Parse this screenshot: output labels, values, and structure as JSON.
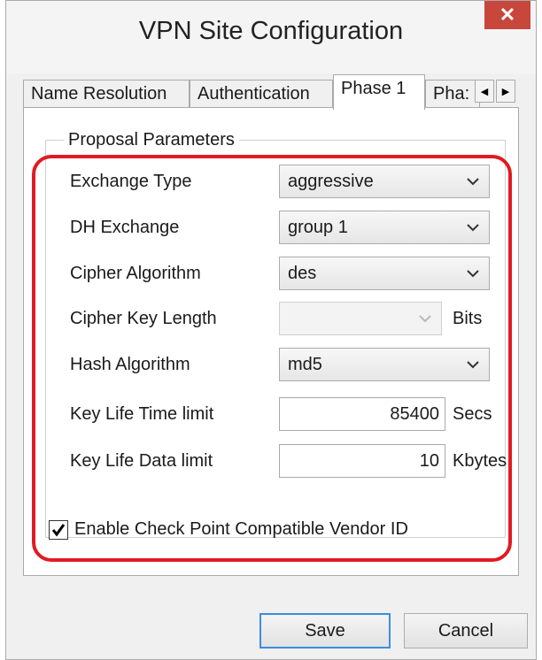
{
  "window": {
    "title": "VPN Site Configuration",
    "close_glyph": "✕"
  },
  "tabs": [
    {
      "label": "Name Resolution",
      "active": false
    },
    {
      "label": "Authentication",
      "active": false
    },
    {
      "label": "Phase 1",
      "active": true
    },
    {
      "label": "Pha:",
      "active": false
    }
  ],
  "tab_scroll": {
    "left_glyph": "◀",
    "right_glyph": "▶"
  },
  "group": {
    "legend": "Proposal Parameters",
    "exchange_type": {
      "label": "Exchange Type",
      "value": "aggressive"
    },
    "dh_exchange": {
      "label": "DH Exchange",
      "value": "group 1"
    },
    "cipher_algorithm": {
      "label": "Cipher Algorithm",
      "value": "des"
    },
    "cipher_key_length": {
      "label": "Cipher Key Length",
      "value": "",
      "unit": "Bits",
      "disabled": true
    },
    "hash_algorithm": {
      "label": "Hash Algorithm",
      "value": "md5"
    },
    "key_life_time": {
      "label": "Key Life Time limit",
      "value": "85400",
      "unit": "Secs"
    },
    "key_life_data": {
      "label": "Key Life Data limit",
      "value": "10",
      "unit": "Kbytes"
    }
  },
  "checkbox": {
    "label": "Enable Check Point Compatible Vendor ID",
    "checked": true
  },
  "buttons": {
    "save": "Save",
    "cancel": "Cancel"
  },
  "colors": {
    "highlight": "#e01b22",
    "close": "#c7473c",
    "default_button_border": "#3c8fd9"
  },
  "icons": {
    "dropdown": "chevron-down-icon",
    "check": "checkmark-icon"
  }
}
